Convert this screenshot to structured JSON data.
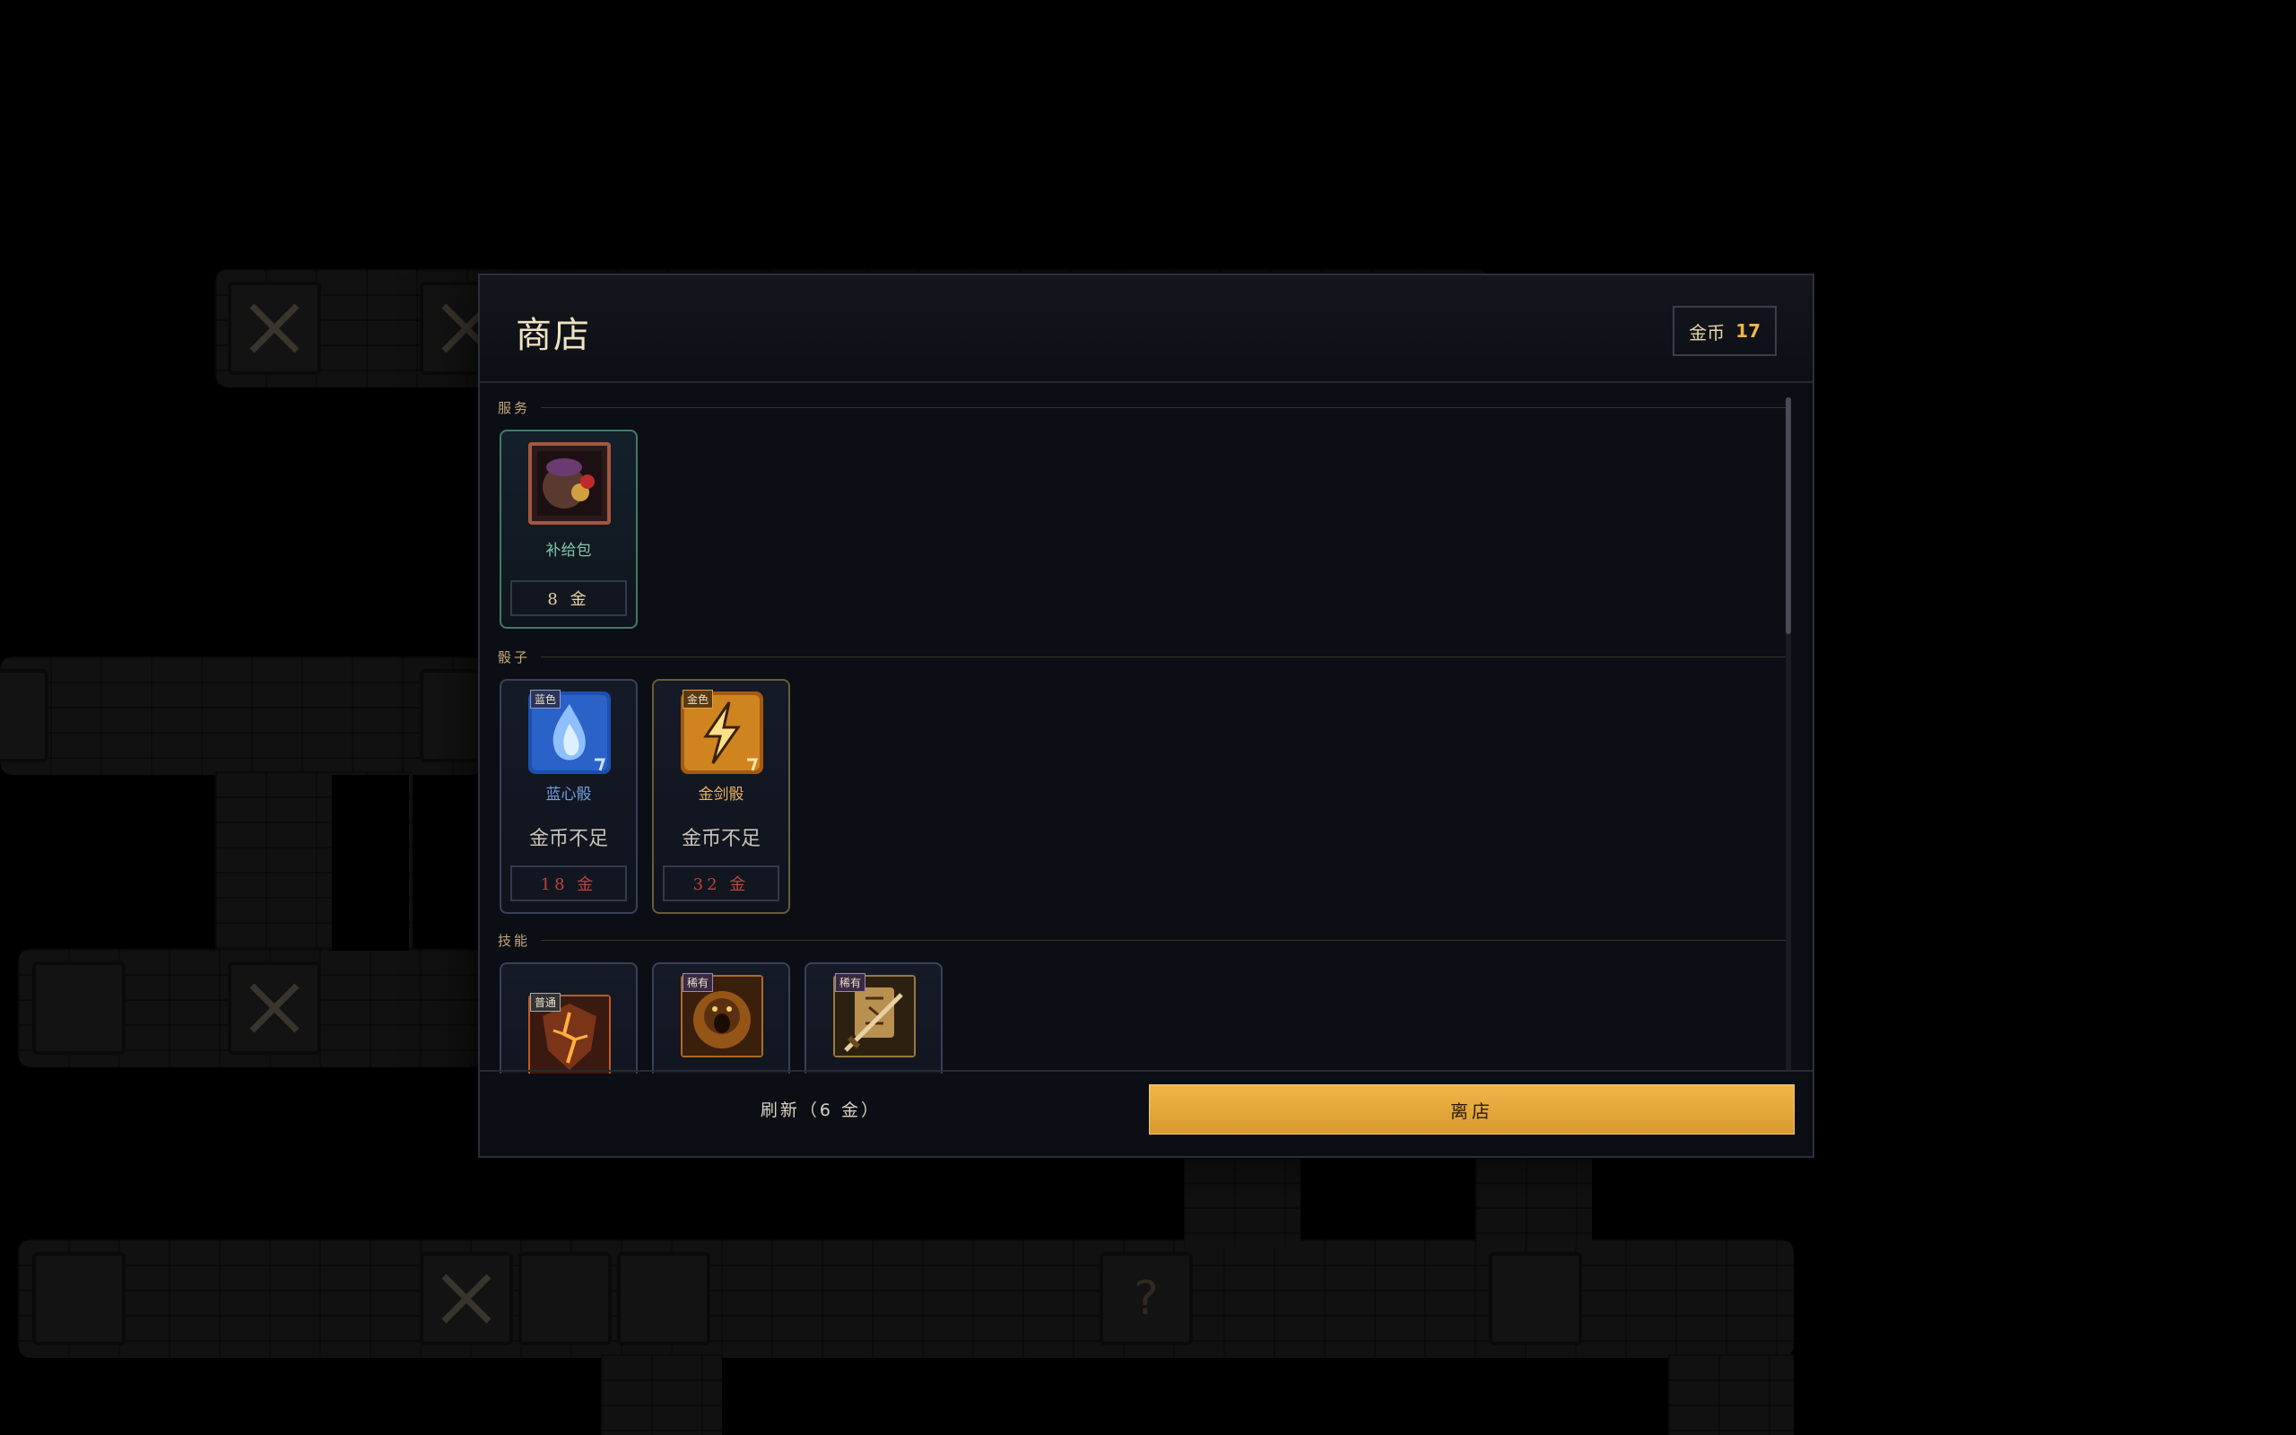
{
  "shop": {
    "title": "商店",
    "gold_label": "金币",
    "gold_value": "17",
    "sections": [
      {
        "title": "服务",
        "items": [
          {
            "name": "补给包",
            "price": "8 金",
            "icon": "supply-bag-icon"
          }
        ]
      },
      {
        "title": "骰子",
        "items": [
          {
            "name": "蓝心骰",
            "rarity": "蓝色",
            "status": "金币不足",
            "price": "18 金",
            "icon": "blue-flame-dice-icon"
          },
          {
            "name": "金剑骰",
            "rarity": "金色",
            "status": "金币不足",
            "price": "32 金",
            "icon": "lightning-dice-icon"
          }
        ]
      },
      {
        "title": "技能",
        "items": [
          {
            "rarity": "普通",
            "icon": "cracked-shield-skill-icon"
          },
          {
            "rarity": "稀有",
            "icon": "roaring-beast-skill-icon"
          },
          {
            "rarity": "稀有",
            "icon": "rune-sword-skill-icon"
          }
        ]
      }
    ],
    "footer": {
      "refresh_label": "刷新（6 金）",
      "leave_label": "离店"
    }
  },
  "map": {
    "unknown_tile_glyph": "?"
  },
  "colors": {
    "accent_gold": "#f0b44a",
    "service_name": "#7fc9a8",
    "blue_name": "#6f9fe0",
    "gold_name": "#e8b25a",
    "insufficient_red": "#c04040"
  }
}
